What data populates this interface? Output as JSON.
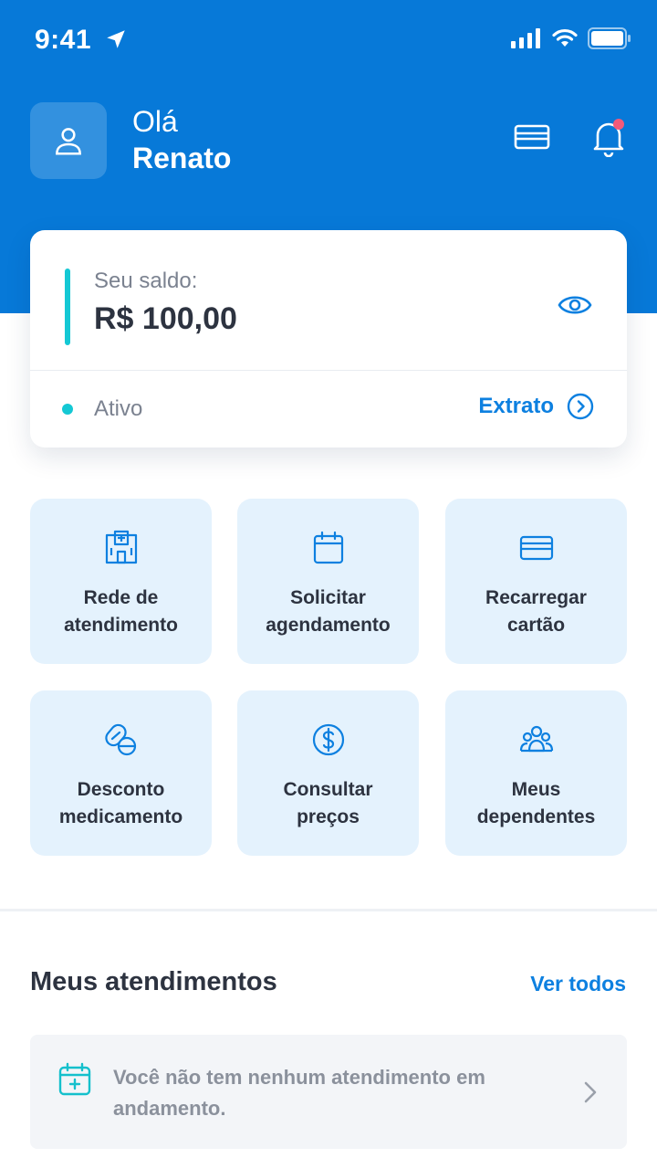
{
  "status_bar": {
    "time": "9:41"
  },
  "header": {
    "greeting": "Olá",
    "user_name": "Renato"
  },
  "balance": {
    "label": "Seu saldo:",
    "value": "R$ 100,00",
    "status": "Ativo",
    "statement_link": "Extrato"
  },
  "tiles": [
    {
      "line1": "Rede de",
      "line2": "atendimento",
      "icon": "hospital-icon"
    },
    {
      "line1": "Solicitar",
      "line2": "agendamento",
      "icon": "calendar-icon"
    },
    {
      "line1": "Recarregar",
      "line2": "cartão",
      "icon": "card-icon"
    },
    {
      "line1": "Desconto",
      "line2": "medicamento",
      "icon": "pills-icon"
    },
    {
      "line1": "Consultar",
      "line2": "preços",
      "icon": "dollar-icon"
    },
    {
      "line1": "Meus",
      "line2": "dependentes",
      "icon": "people-icon"
    }
  ],
  "appointments": {
    "title": "Meus atendimentos",
    "see_all": "Ver todos",
    "empty_message": "Você não tem nenhum atendimento em andamento."
  },
  "colors": {
    "primary": "#0779d8",
    "accent": "#14c8d4",
    "link": "#0d80e0",
    "tile_bg": "#e4f2fd",
    "notification_dot": "#f25a7a"
  }
}
